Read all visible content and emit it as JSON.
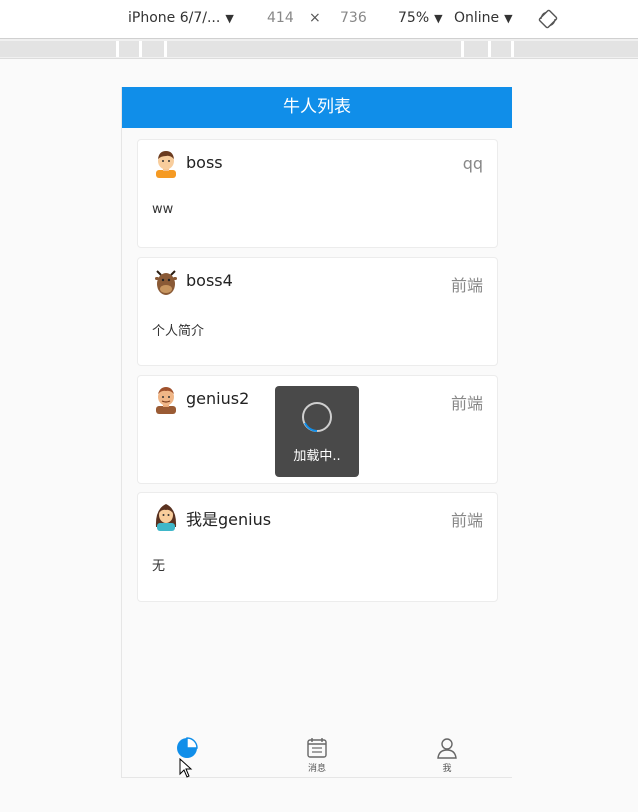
{
  "devtools": {
    "device": "iPhone 6/7/...",
    "width": "414",
    "times": "×",
    "height": "736",
    "zoom": "75%",
    "network": "Online"
  },
  "app": {
    "title": "牛人列表",
    "cards": [
      {
        "name": "boss",
        "extra": "qq",
        "desc": "ww",
        "avatar": "boy-avatar-icon"
      },
      {
        "name": "boss4",
        "extra": "前端",
        "desc": "个人简介",
        "avatar": "bull-avatar-icon"
      },
      {
        "name": "genius2",
        "extra": "前端",
        "desc": "",
        "avatar": "man-avatar-icon"
      },
      {
        "name": "我是genius",
        "extra": "前端",
        "desc": "无",
        "avatar": "girl-avatar-icon"
      }
    ],
    "toast": "加载中..",
    "tabs": [
      {
        "label": "",
        "icon": "pie-chart-icon",
        "active": true
      },
      {
        "label": "消息",
        "icon": "message-icon",
        "active": false
      },
      {
        "label": "我",
        "icon": "user-icon",
        "active": false
      }
    ]
  },
  "colors": {
    "brand": "#108ee9",
    "background": "#fafafa"
  }
}
